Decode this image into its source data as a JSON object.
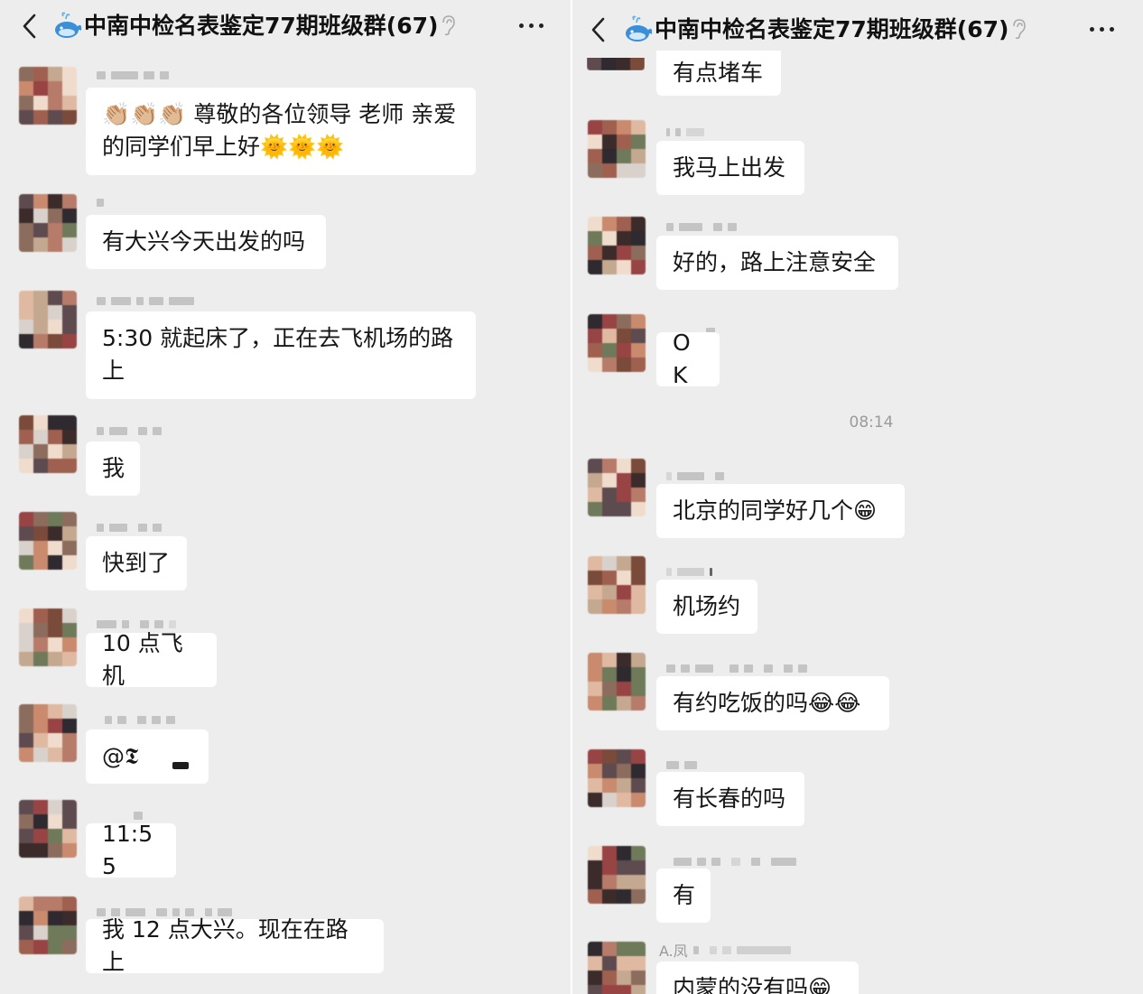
{
  "left": {
    "back_icon": "chevron-left-icon",
    "group_icon": "whale-icon",
    "title": "中南中检名表鉴定77期班级群(67)",
    "mute_icon": "ear-icon",
    "more_icon": "more-dots-icon",
    "messages": [
      {
        "text": "👏🏼👏🏼👏🏼 尊敬的各位领导 老师 亲爱的同学们早上好🌞🌞🌞"
      },
      {
        "text": "有大兴今天出发的吗"
      },
      {
        "text": "5:30 就起床了，正在去飞机场的路上"
      },
      {
        "text": "我"
      },
      {
        "text": "快到了"
      },
      {
        "text": "10 点飞机"
      },
      {
        "text": "@𝕿"
      },
      {
        "text": "11:55"
      },
      {
        "text": "我 12 点大兴。现在在路上"
      }
    ]
  },
  "right": {
    "back_icon": "chevron-left-icon",
    "group_icon": "whale-icon",
    "title": "中南中检名表鉴定77期班级群(67)",
    "mute_icon": "ear-icon",
    "more_icon": "more-dots-icon",
    "timestamp": "08:14",
    "messages": [
      {
        "text": "有点堵车"
      },
      {
        "text": "我马上出发"
      },
      {
        "text": "好的，路上注意安全"
      },
      {
        "text": "OK"
      },
      {
        "text": "北京的同学好几个😁"
      },
      {
        "text": "机场约"
      },
      {
        "text": "有约吃饭的吗😂😂"
      },
      {
        "text": "有长春的吗"
      },
      {
        "text": "有"
      },
      {
        "nick": "A.凤",
        "text": "内蒙的没有吗😁"
      }
    ]
  },
  "colors": {
    "chat_background": "#ededed",
    "bubble": "#ffffff",
    "text": "#161616",
    "timestamp": "#9b9b9b"
  }
}
